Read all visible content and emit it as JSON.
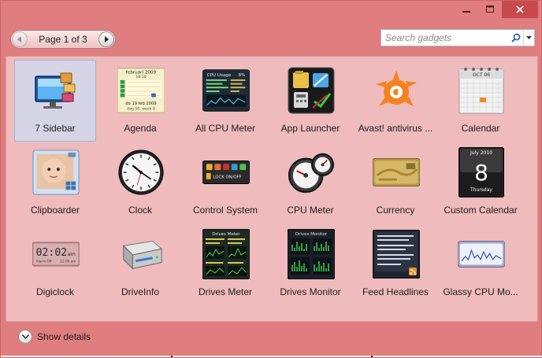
{
  "window": {
    "controls": {
      "minimize_icon": "minimize-icon",
      "maximize_icon": "maximize-icon",
      "close_icon": "close-icon"
    }
  },
  "pager": {
    "label": "Page 1 of 3",
    "current_page": 1,
    "total_pages": 3
  },
  "search": {
    "placeholder": "Search gadgets"
  },
  "gadgets": [
    {
      "label": "7 Sidebar",
      "selected": true
    },
    {
      "label": "Agenda"
    },
    {
      "label": "All CPU Meter"
    },
    {
      "label": "App Launcher"
    },
    {
      "label": "Avast! antivirus ..."
    },
    {
      "label": "Calendar"
    },
    {
      "label": "Clipboarder"
    },
    {
      "label": "Clock"
    },
    {
      "label": "Control System"
    },
    {
      "label": "CPU Meter"
    },
    {
      "label": "Currency"
    },
    {
      "label": "Custom Calendar"
    },
    {
      "label": "Digiclock"
    },
    {
      "label": "DriveInfo"
    },
    {
      "label": "Drives Meter"
    },
    {
      "label": "Drives Monitor"
    },
    {
      "label": "Feed Headlines"
    },
    {
      "label": "Glassy CPU Mo..."
    }
  ],
  "thumb_text": {
    "agenda_month": "februari 2009",
    "agenda_time": "18:18",
    "agenda_date": "do 19 feb 2009",
    "agenda_week": "dag 50, week 8",
    "cpu_title": "CPU Usage",
    "cpu_pct": "8%",
    "calendar_month": "OCT 06",
    "control_lock": "LOCK ON/OFF",
    "custom_month": "July 2010",
    "custom_day": "8",
    "custom_weekday": "Thursday",
    "digiclock_time": "02:02",
    "digiclock_ampm": "am",
    "digiclock_alarm": "Alarm Off",
    "digiclock_date": "12:00 am",
    "drives_meter_title": "Drives Meter",
    "drives_monitor_title": "Drives Monitor"
  },
  "footer": {
    "details_label": "Show details"
  }
}
